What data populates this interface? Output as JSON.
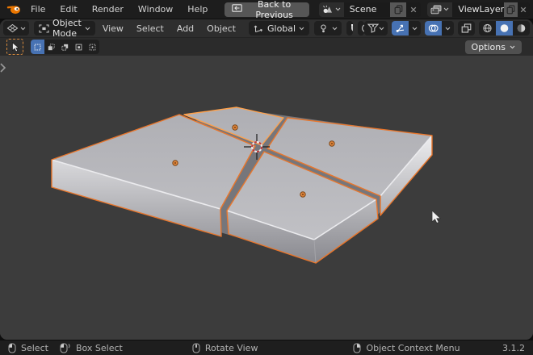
{
  "topbar": {
    "menus": [
      "File",
      "Edit",
      "Render",
      "Window",
      "Help"
    ],
    "back_button": "Back to Previous",
    "scene": {
      "value": "Scene"
    },
    "view_layer": {
      "value": "ViewLayer"
    }
  },
  "header": {
    "mode": "Object Mode",
    "menus": [
      "View",
      "Select",
      "Add",
      "Object"
    ],
    "orientation": "Global"
  },
  "tool_settings": {
    "options": "Options"
  },
  "statusbar": {
    "hints": [
      "Select",
      "Box Select",
      "Rotate View",
      "Object Context Menu"
    ],
    "version": "3.1.2"
  },
  "colors": {
    "accent_blue": "#4772B3",
    "selection_orange": "#E8762C",
    "active_orange": "#FFA14B",
    "viewport_bg": "#3C3C3C"
  }
}
